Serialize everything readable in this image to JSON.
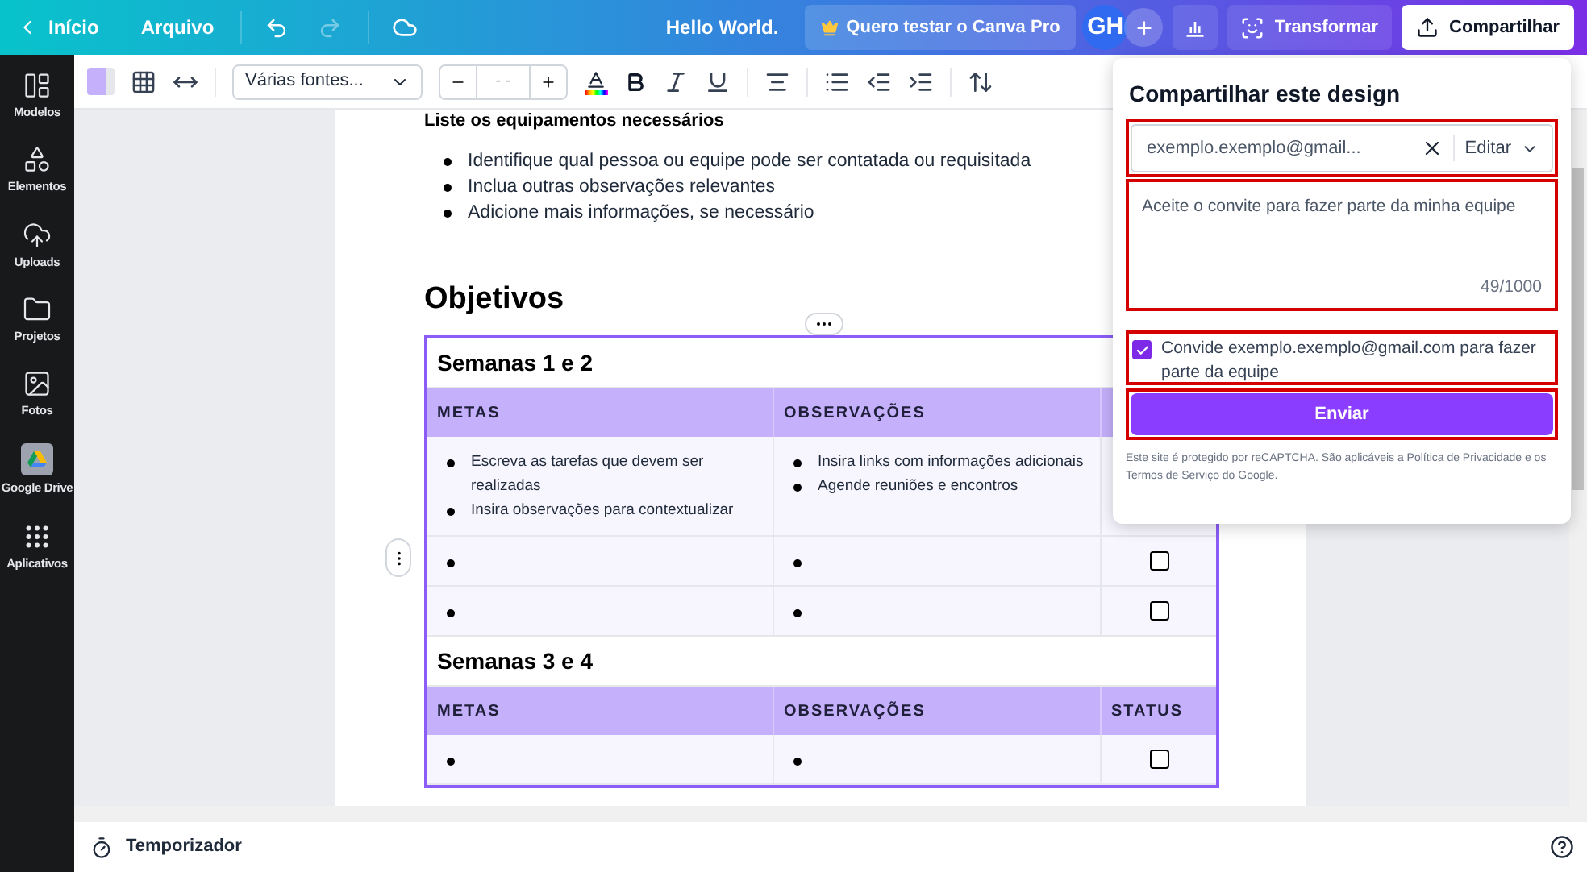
{
  "top_bar": {
    "home": "Início",
    "file": "Arquivo",
    "title": "Hello World.",
    "pro_button": "Quero testar o Canva Pro",
    "avatar": "GH",
    "transform_button": "Transformar",
    "share_button": "Compartilhar"
  },
  "sidebar": {
    "items": [
      {
        "kind": "templates",
        "label": "Modelos"
      },
      {
        "kind": "elements",
        "label": "Elementos"
      },
      {
        "kind": "uploads",
        "label": "Uploads"
      },
      {
        "kind": "projects",
        "label": "Projetos"
      },
      {
        "kind": "photos",
        "label": "Fotos"
      },
      {
        "kind": "drive",
        "label": "Google Drive"
      },
      {
        "kind": "apps",
        "label": "Aplicativos"
      }
    ]
  },
  "toolbar": {
    "font": "Várias fontes...",
    "font_size": "- -"
  },
  "document": {
    "section_heading": "Liste os equipamentos necessários",
    "bullets": [
      "Identifique qual pessoa ou equipe pode ser contatada ou requisitada",
      "Inclua outras observações relevantes",
      "Adicione mais informações, se necessário"
    ],
    "heading": "Objetivos",
    "tables": [
      {
        "title": "Semanas 1 e 2",
        "columns": [
          "METAS",
          "OBSERVAÇÕES"
        ],
        "rows": [
          {
            "goals": [
              {
                "kind": "text",
                "text": "Escreva as tarefas que devem ser realizadas"
              },
              {
                "kind": "text",
                "text": "Insira observações para contextualizar"
              }
            ],
            "notes": [
              {
                "kind": "text",
                "text": "Insira links com informações adicionais"
              },
              {
                "kind": "text",
                "text": "Agende reuniões e encontros"
              }
            ]
          },
          {
            "goals": [
              {
                "kind": "empty"
              }
            ],
            "notes": [
              {
                "kind": "empty"
              }
            ],
            "status": {
              "checked": false
            }
          },
          {
            "goals": [
              {
                "kind": "empty"
              }
            ],
            "notes": [
              {
                "kind": "empty"
              }
            ],
            "status": {
              "checked": false
            }
          }
        ]
      },
      {
        "title": "Semanas 3 e 4",
        "columns": [
          "METAS",
          "OBSERVAÇÕES",
          "STATUS"
        ],
        "rows": [
          {
            "goals": [
              {
                "kind": "empty"
              }
            ],
            "notes": [
              {
                "kind": "empty"
              }
            ],
            "status": {
              "checked": false
            }
          }
        ]
      }
    ]
  },
  "share_panel": {
    "title": "Compartilhar este design",
    "email": "exemplo.exemplo@gmail...",
    "permission": "Editar",
    "message": "Aceite o convite para fazer parte da minha equipe",
    "counter": "49/1000",
    "invite": {
      "checked": true,
      "label": "Convide exemplo.exemplo@gmail.com para fazer parte da equipe"
    },
    "send_button": "Enviar",
    "notice": "Este site é protegido por reCAPTCHA. São aplicáveis a Política de Privacidade e os Termos de Serviço do Google."
  },
  "status_bar": {
    "timer": "Temporizador"
  }
}
